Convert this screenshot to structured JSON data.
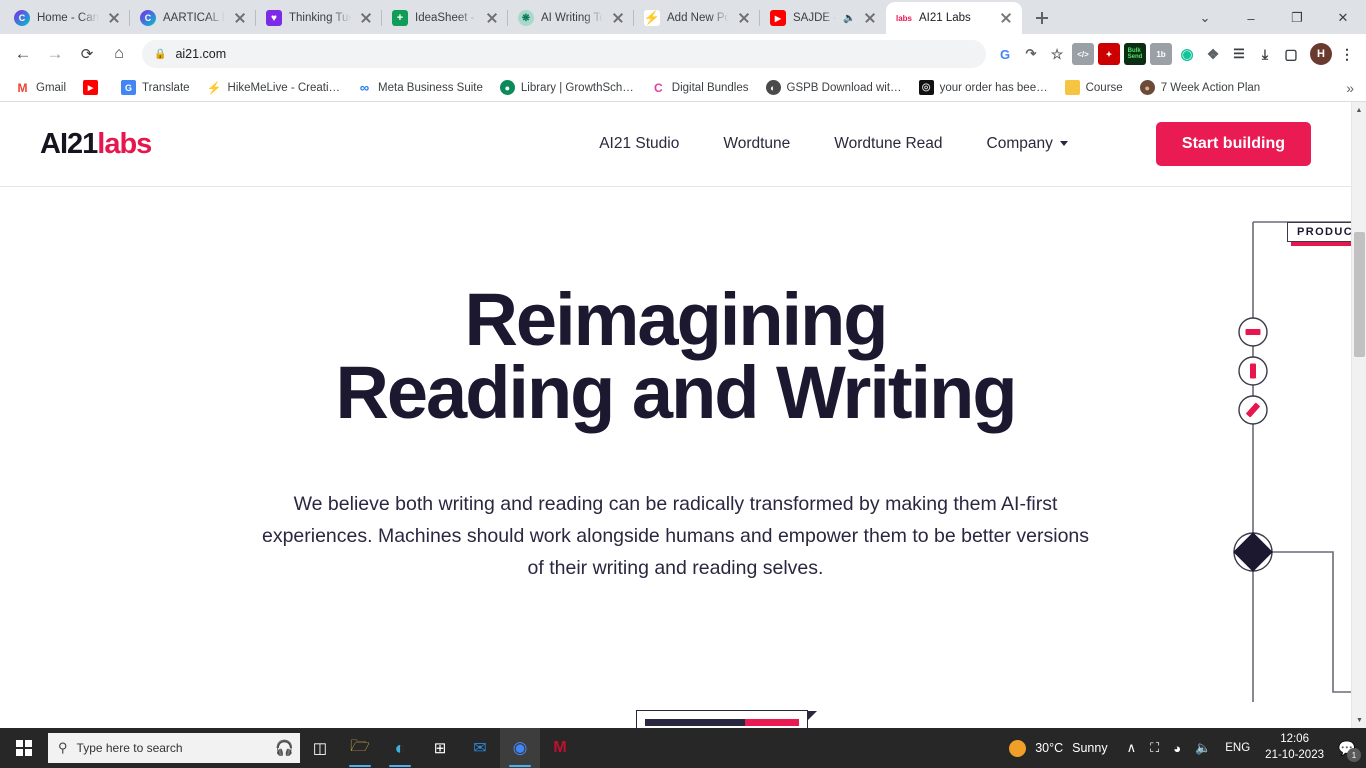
{
  "browser": {
    "tabs": [
      {
        "title": "Home - Canv",
        "favicon": "canva-icon",
        "muted": false,
        "active": false
      },
      {
        "title": "AARTICAL PO",
        "favicon": "canva-icon",
        "muted": false,
        "active": false
      },
      {
        "title": "Thinking Tue",
        "favicon": "heart-icon",
        "muted": false,
        "active": false
      },
      {
        "title": "IdeaSheet - H",
        "favicon": "sheets-icon",
        "muted": false,
        "active": false
      },
      {
        "title": "AI Writing To",
        "favicon": "openai-icon",
        "muted": false,
        "active": false
      },
      {
        "title": "Add New Po",
        "favicon": "lightning-icon",
        "muted": false,
        "active": false
      },
      {
        "title": "SAJDE -",
        "favicon": "youtube-icon",
        "muted": true,
        "active": false
      },
      {
        "title": "AI21 Labs",
        "favicon": "ai21-labs-icon",
        "muted": false,
        "active": true
      }
    ],
    "new_tab_label": "+",
    "window_controls": {
      "expand": "⌄",
      "minimize": "–",
      "maximize": "❐",
      "close": "✕"
    },
    "toolbar": {
      "back": "←",
      "forward": "→",
      "reload": "⟳",
      "home": "⌂",
      "url": "ai21.com",
      "lock_icon": "lock-icon",
      "menu": "⋮"
    },
    "extensions": [
      {
        "name": "google-lens-icon",
        "glyph": "G",
        "bg": "#ffffff",
        "fg": "#4285f4"
      },
      {
        "name": "share-icon",
        "glyph": "↱",
        "bg": "#ffffff",
        "fg": "#5f6368"
      },
      {
        "name": "bookmark-star-icon",
        "glyph": "☆",
        "bg": "#ffffff",
        "fg": "#5f6368"
      },
      {
        "name": "code-extension-icon",
        "glyph": "</>",
        "bg": "#9aa0a6",
        "fg": "#ffffff"
      },
      {
        "name": "magic-wand-extension-icon",
        "glyph": "✨",
        "bg": "#cc0000",
        "fg": "#ffffff"
      },
      {
        "name": "bulk-send-extension-icon",
        "glyph": "Bulk",
        "bg": "#0b2e13",
        "fg": "#55e06a"
      },
      {
        "name": "onetab-extension-icon",
        "glyph": "1b",
        "bg": "#9aa0a6",
        "fg": "#ffffff"
      },
      {
        "name": "grammarly-extension-icon",
        "glyph": "◉",
        "bg": "#ffffff",
        "fg": "#15c39a"
      },
      {
        "name": "puzzle-extensions-icon",
        "glyph": "❖",
        "bg": "#ffffff",
        "fg": "#5f6368"
      },
      {
        "name": "playlist-icon",
        "glyph": "☰",
        "bg": "#ffffff",
        "fg": "#3c4043"
      },
      {
        "name": "downloads-icon",
        "glyph": "⤓",
        "bg": "#ffffff",
        "fg": "#3c4043"
      },
      {
        "name": "sidepanel-icon",
        "glyph": "▢",
        "bg": "#ffffff",
        "fg": "#3c4043"
      }
    ],
    "profile_initial": "H",
    "bookmarks": [
      {
        "label": "Gmail",
        "icon": "gmail-icon",
        "glyph": "M",
        "bg": "#ffffff",
        "fg": "#ea4335"
      },
      {
        "label": "",
        "icon": "youtube-icon",
        "glyph": "▶",
        "bg": "#ff0000",
        "fg": "#ffffff"
      },
      {
        "label": "Translate",
        "icon": "google-translate-icon",
        "glyph": "G",
        "bg": "#4285f4",
        "fg": "#ffffff"
      },
      {
        "label": "HikeMeLive - Creati…",
        "icon": "lightning-icon",
        "glyph": "⚡",
        "bg": "#ffffff",
        "fg": "#4c6ef5"
      },
      {
        "label": "Meta Business Suite",
        "icon": "meta-icon",
        "glyph": "∞",
        "bg": "#ffffff",
        "fg": "#1877f2"
      },
      {
        "label": "Library | GrowthSch…",
        "icon": "growthschool-icon",
        "glyph": "●",
        "bg": "#0b8a5a",
        "fg": "#ffffff"
      },
      {
        "label": "Digital Bundles",
        "icon": "canva-icon",
        "glyph": "C",
        "bg": "#ffffff",
        "fg": "#e040a0"
      },
      {
        "label": "GSPB Download wit…",
        "icon": "globe-icon",
        "glyph": "◔",
        "bg": "#4a4a4a",
        "fg": "#ffffff"
      },
      {
        "label": "your order has bee…",
        "icon": "dark-circle-icon",
        "glyph": "◎",
        "bg": "#111111",
        "fg": "#cfcfcf"
      },
      {
        "label": "Course",
        "icon": "folder-icon",
        "glyph": "▮",
        "bg": "#f5c542",
        "fg": "#f5c542"
      },
      {
        "label": "7 Week Action Plan",
        "icon": "avatar-icon",
        "glyph": "●",
        "bg": "#6b4a3a",
        "fg": "#d8b48a"
      }
    ],
    "bookmarks_overflow": "»"
  },
  "site": {
    "logo": {
      "part1": "AI21",
      "part2": "labs"
    },
    "nav": [
      {
        "label": "AI21 Studio",
        "has_caret": false
      },
      {
        "label": "Wordtune",
        "has_caret": false
      },
      {
        "label": "Wordtune Read",
        "has_caret": false
      },
      {
        "label": "Company",
        "has_caret": true
      }
    ],
    "cta_label": "Start building",
    "hero": {
      "title_line1": "Reimagining",
      "title_line2": "Reading and Writing",
      "paragraph": "We believe both writing and reading can be radically transformed by making them AI-first experiences. Machines should work alongside humans and empower them to be better versions of their writing and reading selves."
    },
    "decoration": {
      "product_label": "PRODUC",
      "accent_color": "#e8164f",
      "line_color": "#6b6b76",
      "node_color": "#1b1830"
    }
  },
  "scrollbar": {
    "up_arrow": "▲",
    "down_arrow": "▼"
  },
  "taskbar": {
    "search_placeholder": "Type here to search",
    "search_icon": "search-icon",
    "start_icon": "windows-start-icon",
    "pinned": [
      {
        "name": "task-view-icon",
        "glyph": "⌸"
      },
      {
        "name": "file-explorer-icon",
        "glyph": "🗀"
      },
      {
        "name": "microsoft-edge-icon",
        "glyph": "◔"
      },
      {
        "name": "microsoft-store-icon",
        "glyph": "⊞"
      },
      {
        "name": "mail-icon",
        "glyph": "✉"
      },
      {
        "name": "google-chrome-icon",
        "glyph": "◉"
      },
      {
        "name": "mcafee-icon",
        "glyph": "M"
      }
    ],
    "tray": {
      "show_hidden": "∧",
      "camera_icon": "camera-icon",
      "wifi_icon": "wifi-icon",
      "volume_icon": "volume-icon",
      "language": "ENG",
      "weather_temp": "30°C",
      "weather_desc": "Sunny",
      "time": "12:06",
      "date": "21-10-2023",
      "notification_count": "1"
    }
  }
}
